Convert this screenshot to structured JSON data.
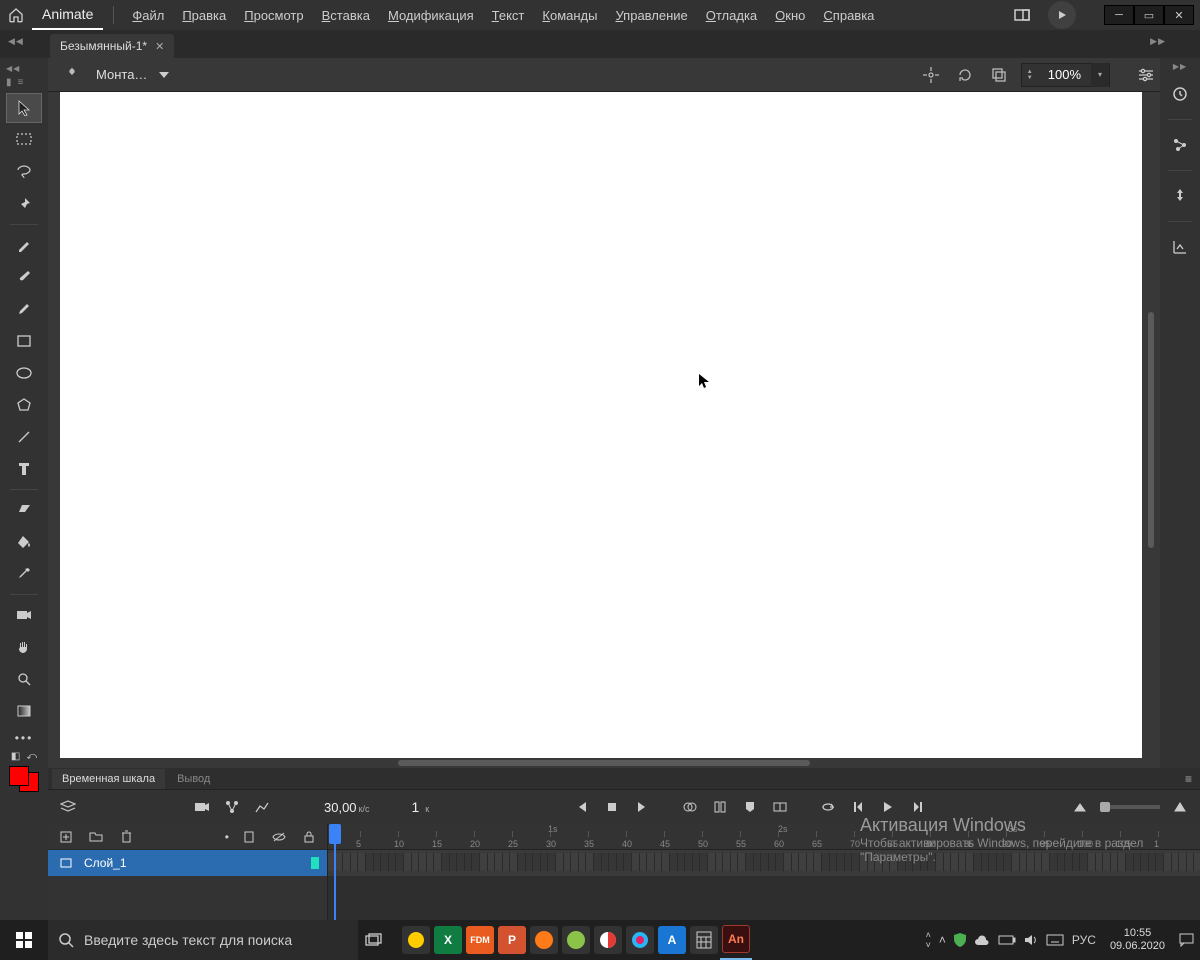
{
  "app": {
    "name": "Animate"
  },
  "menu": [
    "Файл",
    "Правка",
    "Просмотр",
    "Вставка",
    "Модификация",
    "Текст",
    "Команды",
    "Управление",
    "Отладка",
    "Окно",
    "Справка"
  ],
  "doc": {
    "tab": "Безымянный-1*",
    "scene": "Монта…"
  },
  "zoom": {
    "value": "100%"
  },
  "fps": {
    "value": "30,00",
    "unit": "к/с"
  },
  "frame": {
    "value": "1",
    "unit": "к"
  },
  "timeline": {
    "tabs": [
      "Временная шкала",
      "Вывод"
    ],
    "layer": "Слой_1",
    "seconds": [
      "1s",
      "2s",
      "3s"
    ],
    "ticks": [
      "5",
      "10",
      "15",
      "20",
      "25",
      "30",
      "35",
      "40",
      "45",
      "50",
      "55",
      "60",
      "65",
      "70",
      "75",
      "80",
      "85",
      "90",
      "95",
      "100",
      "105",
      "1"
    ]
  },
  "watermark": {
    "title": "Активация Windows",
    "sub": "Чтобы активировать Windows, перейдите в раздел \"Параметры\"."
  },
  "taskbar": {
    "search_placeholder": "Введите здесь текст для поиска",
    "lang": "РУС",
    "time": "10:55",
    "date": "09.06.2020"
  }
}
